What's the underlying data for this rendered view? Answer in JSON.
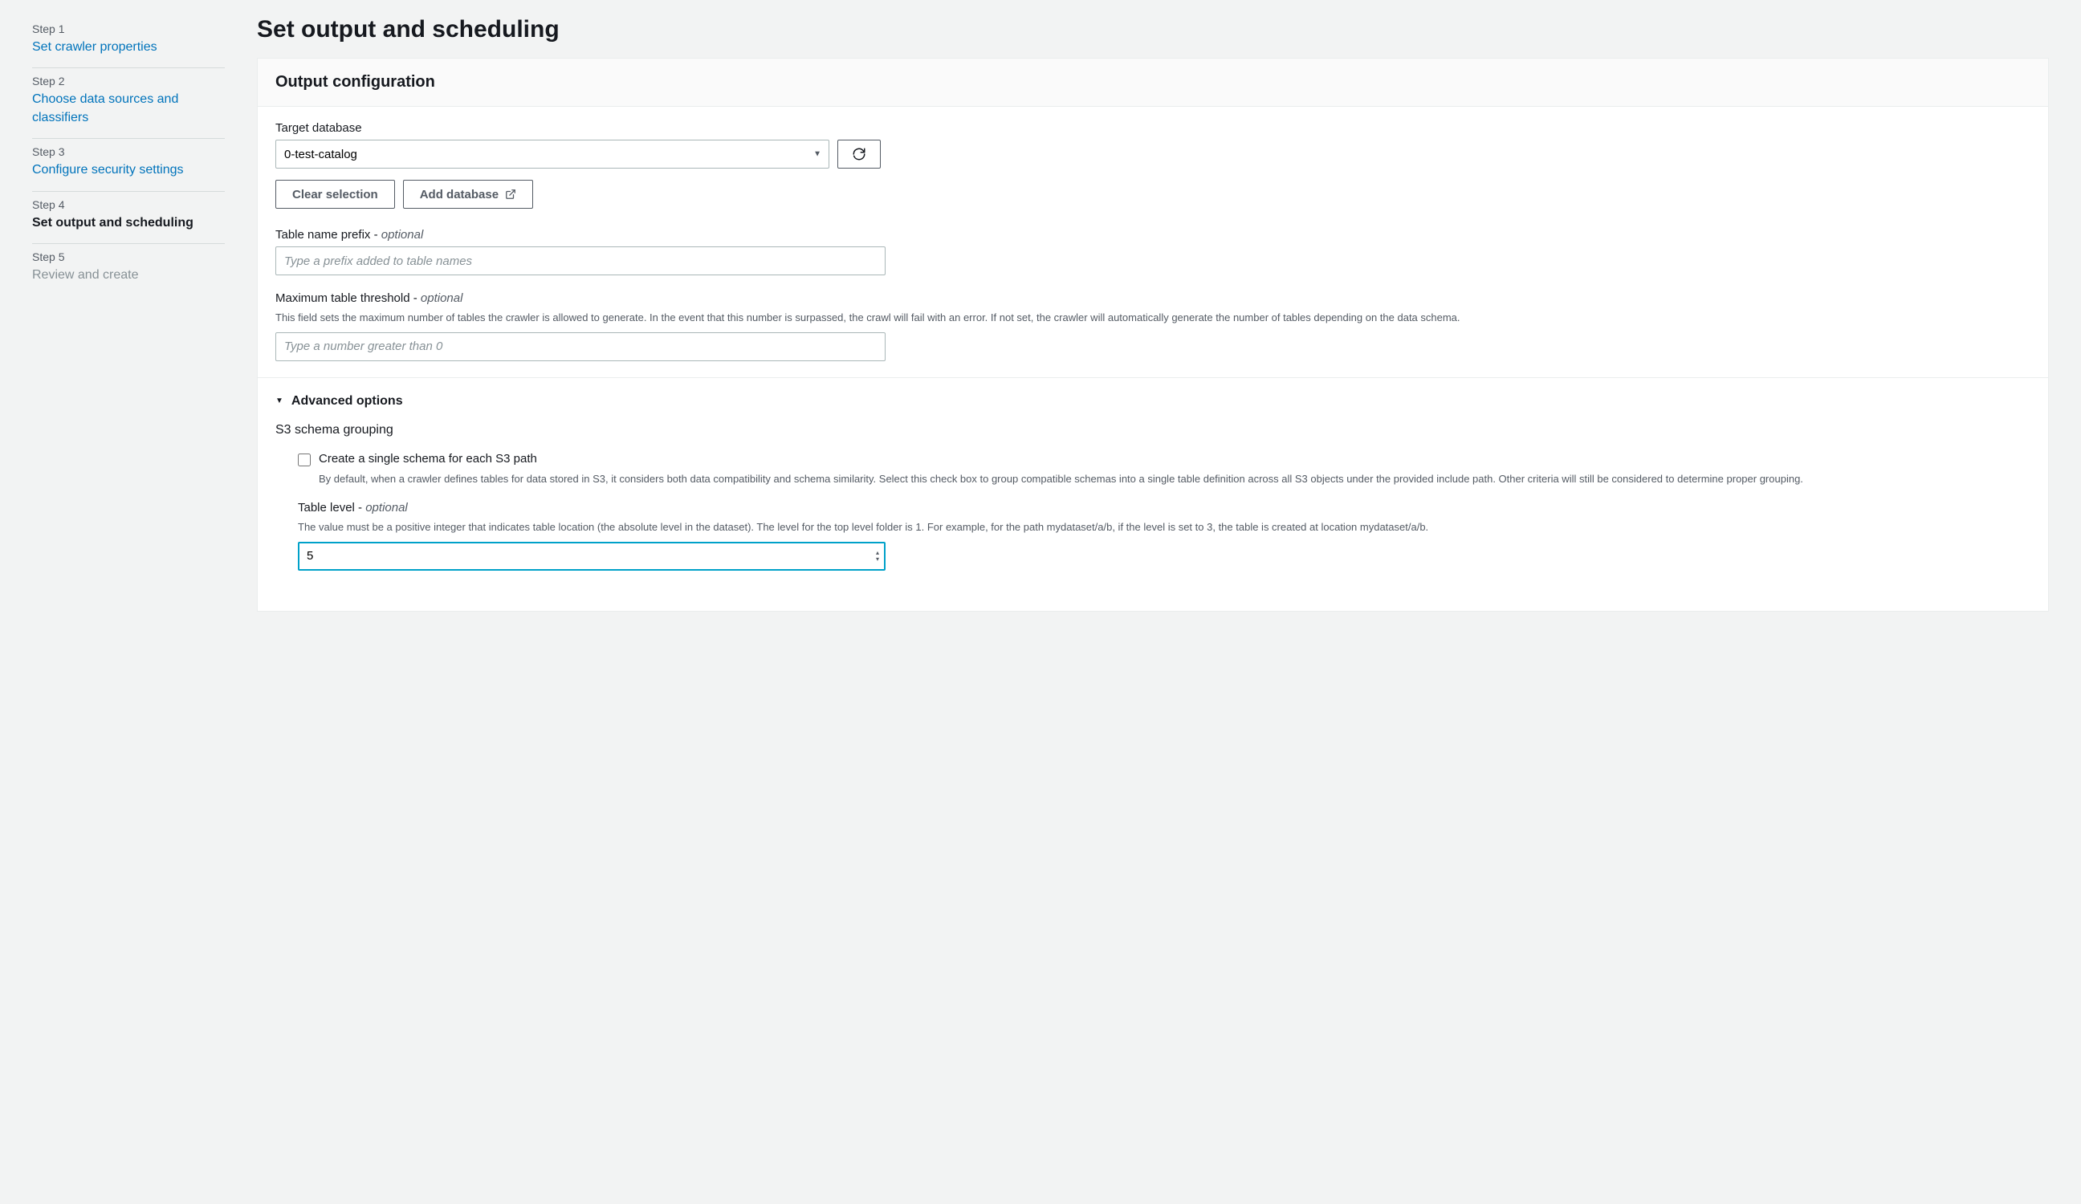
{
  "sidebar": {
    "steps": [
      {
        "label": "Step 1",
        "title": "Set crawler properties",
        "state": "link"
      },
      {
        "label": "Step 2",
        "title": "Choose data sources and classifiers",
        "state": "link"
      },
      {
        "label": "Step 3",
        "title": "Configure security settings",
        "state": "link"
      },
      {
        "label": "Step 4",
        "title": "Set output and scheduling",
        "state": "active"
      },
      {
        "label": "Step 5",
        "title": "Review and create",
        "state": "disabled"
      }
    ]
  },
  "page": {
    "title": "Set output and scheduling"
  },
  "panel": {
    "header": "Output configuration",
    "target_db_label": "Target database",
    "target_db_value": "0-test-catalog",
    "clear_selection_label": "Clear selection",
    "add_database_label": "Add database",
    "prefix_label": "Table name prefix - ",
    "prefix_optional": "optional",
    "prefix_placeholder": "Type a prefix added to table names",
    "threshold_label": "Maximum table threshold - ",
    "threshold_optional": "optional",
    "threshold_help": "This field sets the maximum number of tables the crawler is allowed to generate. In the event that this number is surpassed, the crawl will fail with an error. If not set, the crawler will automatically generate the number of tables depending on the data schema.",
    "threshold_placeholder": "Type a number greater than 0",
    "advanced_options_label": "Advanced options",
    "s3_grouping_label": "S3 schema grouping",
    "single_schema_label": "Create a single schema for each S3 path",
    "single_schema_help": "By default, when a crawler defines tables for data stored in S3, it considers both data compatibility and schema similarity. Select this check box to group compatible schemas into a single table definition across all S3 objects under the provided include path. Other criteria will still be considered to determine proper grouping.",
    "table_level_label": "Table level - ",
    "table_level_optional": "optional",
    "table_level_help": "The value must be a positive integer that indicates table location (the absolute level in the dataset). The level for the top level folder is 1. For example, for the path mydataset/a/b, if the level is set to 3, the table is created at location mydataset/a/b.",
    "table_level_value": "5"
  }
}
